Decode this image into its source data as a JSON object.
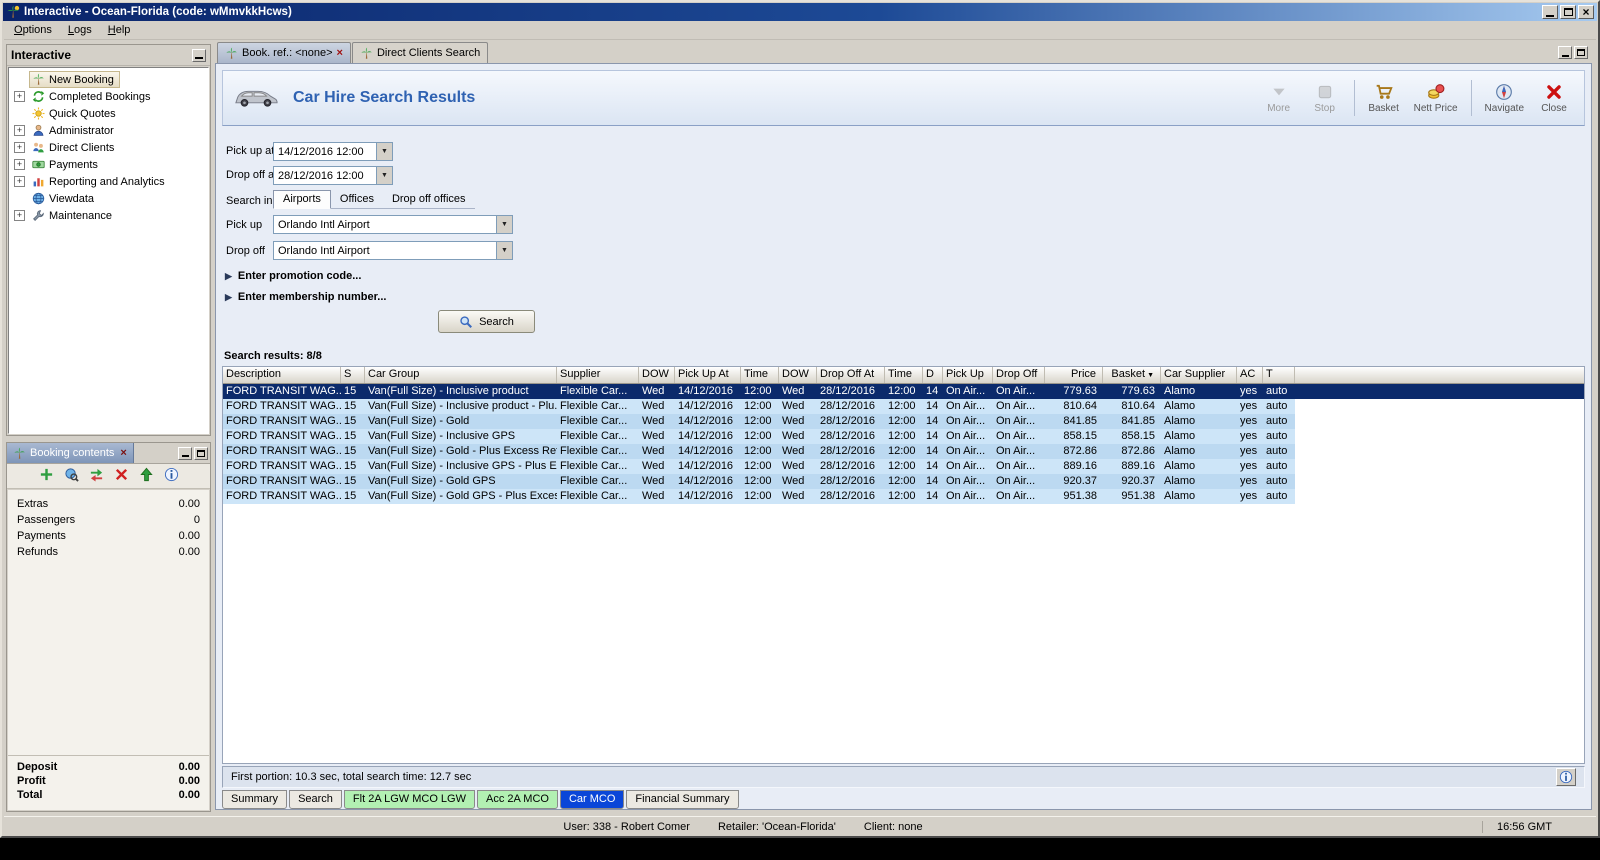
{
  "colors": {
    "titlebar_start": "#0a246a",
    "titlebar_end": "#a6caf0",
    "selected_row_bg": "#0b2a6b",
    "row_alt_a": "#cde5f8",
    "row_alt_b": "#bcd9f1",
    "tab_green": "#b2f0b2",
    "tab_blue": "#0a46d8",
    "doc_title_text": "#2f62b2"
  },
  "window": {
    "title": "Interactive - Ocean-Florida (code: wMmvkkHcws)"
  },
  "menu": {
    "items": [
      {
        "label": "Options"
      },
      {
        "label": "Logs"
      },
      {
        "label": "Help"
      }
    ]
  },
  "sidebar": {
    "title": "Interactive",
    "items": [
      {
        "label": "New Booking",
        "icon": "palm-icon",
        "expandable": false,
        "selected": true
      },
      {
        "label": "Completed Bookings",
        "icon": "completed-bookings-icon",
        "expandable": true,
        "selected": false
      },
      {
        "label": "Quick Quotes",
        "icon": "quick-quotes-icon",
        "expandable": false,
        "selected": false
      },
      {
        "label": "Administrator",
        "icon": "administrator-icon",
        "expandable": true,
        "selected": false
      },
      {
        "label": "Direct Clients",
        "icon": "direct-clients-icon",
        "expandable": true,
        "selected": false
      },
      {
        "label": "Payments",
        "icon": "payments-icon",
        "expandable": true,
        "selected": false
      },
      {
        "label": "Reporting and Analytics",
        "icon": "reporting-icon",
        "expandable": true,
        "selected": false
      },
      {
        "label": "Viewdata",
        "icon": "viewdata-icon",
        "expandable": false,
        "selected": false
      },
      {
        "label": "Maintenance",
        "icon": "maintenance-icon",
        "expandable": true,
        "selected": false
      }
    ]
  },
  "booking_panel": {
    "title": "Booking contents",
    "toolbar": [
      "add",
      "search-globe",
      "swap",
      "delete",
      "move-up",
      "info"
    ],
    "rows": [
      {
        "label": "Extras",
        "value": "0.00"
      },
      {
        "label": "Passengers",
        "value": "0"
      },
      {
        "label": "Payments",
        "value": "0.00"
      },
      {
        "label": "Refunds",
        "value": "0.00"
      }
    ],
    "totals": [
      {
        "label": "Deposit",
        "value": "0.00"
      },
      {
        "label": "Profit",
        "value": "0.00"
      },
      {
        "label": "Total",
        "value": "0.00"
      }
    ]
  },
  "doc_tabs": [
    {
      "label": "Book. ref.: <none>",
      "active": true,
      "closable": true
    },
    {
      "label": "Direct Clients Search",
      "active": false,
      "closable": false
    }
  ],
  "car_hire": {
    "title": "Car Hire Search Results",
    "toolbar": [
      {
        "label": "More",
        "icon": "more-icon",
        "enabled": false
      },
      {
        "label": "Stop",
        "icon": "stop-icon",
        "enabled": false
      },
      {
        "label": "Basket",
        "icon": "basket-icon",
        "enabled": true
      },
      {
        "label": "Nett Price",
        "icon": "nett-price-icon",
        "enabled": true
      },
      {
        "label": "Navigate",
        "icon": "navigate-icon",
        "enabled": true
      },
      {
        "label": "Close",
        "icon": "close-icon",
        "enabled": true
      }
    ],
    "form": {
      "pickup_at": {
        "label": "Pick up at",
        "value": "14/12/2016 12:00"
      },
      "dropoff_at": {
        "label": "Drop off at",
        "value": "28/12/2016 12:00"
      },
      "search_in_label": "Search in",
      "search_in_tabs": [
        {
          "label": "Airports",
          "active": true
        },
        {
          "label": "Offices",
          "active": false
        },
        {
          "label": "Drop off offices",
          "active": false
        }
      ],
      "pickup": {
        "label": "Pick up",
        "value": "Orlando Intl Airport"
      },
      "dropoff": {
        "label": "Drop off",
        "value": "Orlando Intl Airport"
      },
      "promotion": "Enter promotion code...",
      "membership": "Enter membership number...",
      "search_button": "Search"
    },
    "results_label": "Search results: 8/8",
    "table": {
      "selected_index": 0,
      "columns": [
        {
          "label": "Description"
        },
        {
          "label": "S"
        },
        {
          "label": "Car Group"
        },
        {
          "label": "Supplier"
        },
        {
          "label": "DOW"
        },
        {
          "label": "Pick Up At"
        },
        {
          "label": "Time"
        },
        {
          "label": "DOW"
        },
        {
          "label": "Drop Off At"
        },
        {
          "label": "Time"
        },
        {
          "label": "D"
        },
        {
          "label": "Pick Up"
        },
        {
          "label": "Drop Off"
        },
        {
          "label": "Price"
        },
        {
          "label": "Basket",
          "sort": "asc"
        },
        {
          "label": "Car Supplier"
        },
        {
          "label": "AC"
        },
        {
          "label": "T"
        }
      ],
      "rows": [
        [
          "FORD TRANSIT WAG...",
          "15",
          "Van(Full Size) - Inclusive product",
          "Flexible Car...",
          "Wed",
          "14/12/2016",
          "12:00",
          "Wed",
          "28/12/2016",
          "12:00",
          "14",
          "On Air...",
          "On Air...",
          "779.63",
          "779.63",
          "Alamo",
          "yes",
          "auto"
        ],
        [
          "FORD TRANSIT WAG...",
          "15",
          "Van(Full Size) - Inclusive product - Plu...",
          "Flexible Car...",
          "Wed",
          "14/12/2016",
          "12:00",
          "Wed",
          "28/12/2016",
          "12:00",
          "14",
          "On Air...",
          "On Air...",
          "810.64",
          "810.64",
          "Alamo",
          "yes",
          "auto"
        ],
        [
          "FORD TRANSIT WAG...",
          "15",
          "Van(Full Size) - Gold",
          "Flexible Car...",
          "Wed",
          "14/12/2016",
          "12:00",
          "Wed",
          "28/12/2016",
          "12:00",
          "14",
          "On Air...",
          "On Air...",
          "841.85",
          "841.85",
          "Alamo",
          "yes",
          "auto"
        ],
        [
          "FORD TRANSIT WAG...",
          "15",
          "Van(Full Size) - Inclusive GPS",
          "Flexible Car...",
          "Wed",
          "14/12/2016",
          "12:00",
          "Wed",
          "28/12/2016",
          "12:00",
          "14",
          "On Air...",
          "On Air...",
          "858.15",
          "858.15",
          "Alamo",
          "yes",
          "auto"
        ],
        [
          "FORD TRANSIT WAG...",
          "15",
          "Van(Full Size) - Gold - Plus Excess Ref...",
          "Flexible Car...",
          "Wed",
          "14/12/2016",
          "12:00",
          "Wed",
          "28/12/2016",
          "12:00",
          "14",
          "On Air...",
          "On Air...",
          "872.86",
          "872.86",
          "Alamo",
          "yes",
          "auto"
        ],
        [
          "FORD TRANSIT WAG...",
          "15",
          "Van(Full Size) - Inclusive GPS - Plus Ex...",
          "Flexible Car...",
          "Wed",
          "14/12/2016",
          "12:00",
          "Wed",
          "28/12/2016",
          "12:00",
          "14",
          "On Air...",
          "On Air...",
          "889.16",
          "889.16",
          "Alamo",
          "yes",
          "auto"
        ],
        [
          "FORD TRANSIT WAG...",
          "15",
          "Van(Full Size) - Gold GPS",
          "Flexible Car...",
          "Wed",
          "14/12/2016",
          "12:00",
          "Wed",
          "28/12/2016",
          "12:00",
          "14",
          "On Air...",
          "On Air...",
          "920.37",
          "920.37",
          "Alamo",
          "yes",
          "auto"
        ],
        [
          "FORD TRANSIT WAG...",
          "15",
          "Van(Full Size) - Gold GPS - Plus Excess...",
          "Flexible Car...",
          "Wed",
          "14/12/2016",
          "12:00",
          "Wed",
          "28/12/2016",
          "12:00",
          "14",
          "On Air...",
          "On Air...",
          "951.38",
          "951.38",
          "Alamo",
          "yes",
          "auto"
        ]
      ]
    },
    "status_text": "First portion: 10.3 sec, total search time: 12.7 sec",
    "bottom_tabs": [
      {
        "label": "Summary",
        "style": "normal",
        "active": false
      },
      {
        "label": "Search",
        "style": "normal",
        "active": false
      },
      {
        "label": "Flt 2A LGW MCO LGW",
        "style": "green",
        "active": false
      },
      {
        "label": "Acc 2A MCO",
        "style": "green",
        "active": false
      },
      {
        "label": "Car MCO",
        "style": "blue",
        "active": true
      },
      {
        "label": "Financial Summary",
        "style": "normal",
        "active": false
      }
    ]
  },
  "statusbar": {
    "user": "User: 338 - Robert Comer",
    "retailer": "Retailer: 'Ocean-Florida'",
    "client": "Client: none",
    "time": "16:56 GMT"
  }
}
